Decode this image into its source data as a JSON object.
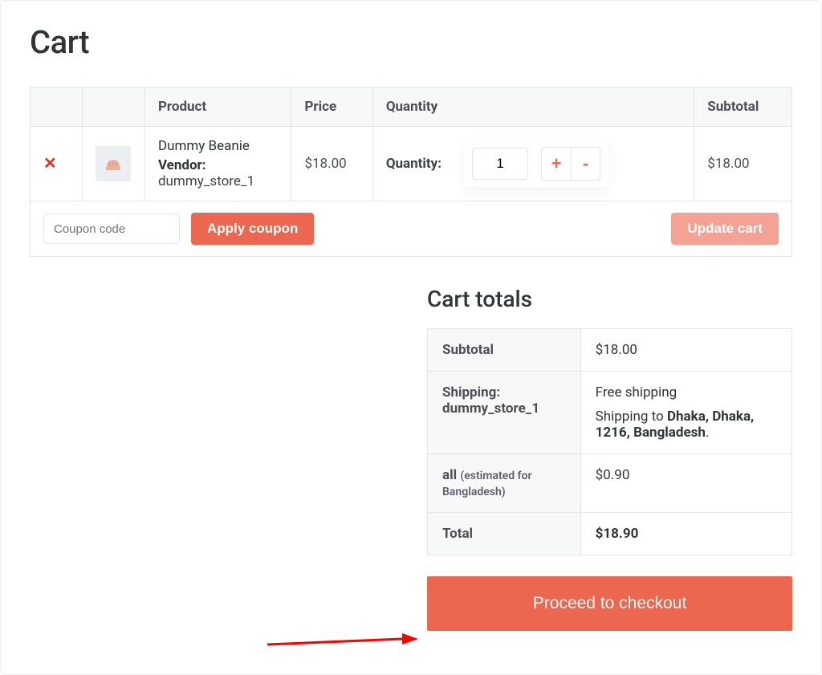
{
  "page": {
    "title": "Cart"
  },
  "table": {
    "headers": {
      "product": "Product",
      "price": "Price",
      "quantity": "Quantity",
      "subtotal": "Subtotal"
    },
    "row": {
      "product_name": "Dummy Beanie",
      "vendor_label": "Vendor:",
      "vendor_name": "dummy_store_1",
      "price": "$18.00",
      "qty_label": "Quantity:",
      "qty_value": "1",
      "subtotal": "$18.00"
    }
  },
  "actions": {
    "coupon_placeholder": "Coupon code",
    "apply_coupon": "Apply coupon",
    "update_cart": "Update cart"
  },
  "totals": {
    "heading": "Cart totals",
    "subtotal_label": "Subtotal",
    "subtotal": "$18.00",
    "shipping_label_prefix": "Shipping:",
    "shipping_label_store": "dummy_store_1",
    "shipping_method": "Free shipping",
    "shipping_to_prefix": "Shipping to ",
    "shipping_dest": "Dhaka, Dhaka, 1216, Bangladesh",
    "tax_prefix": "all",
    "tax_note": "(estimated for Bangladesh)",
    "tax": "$0.90",
    "total_label": "Total",
    "total": "$18.90"
  },
  "checkout": {
    "label": "Proceed to checkout"
  }
}
